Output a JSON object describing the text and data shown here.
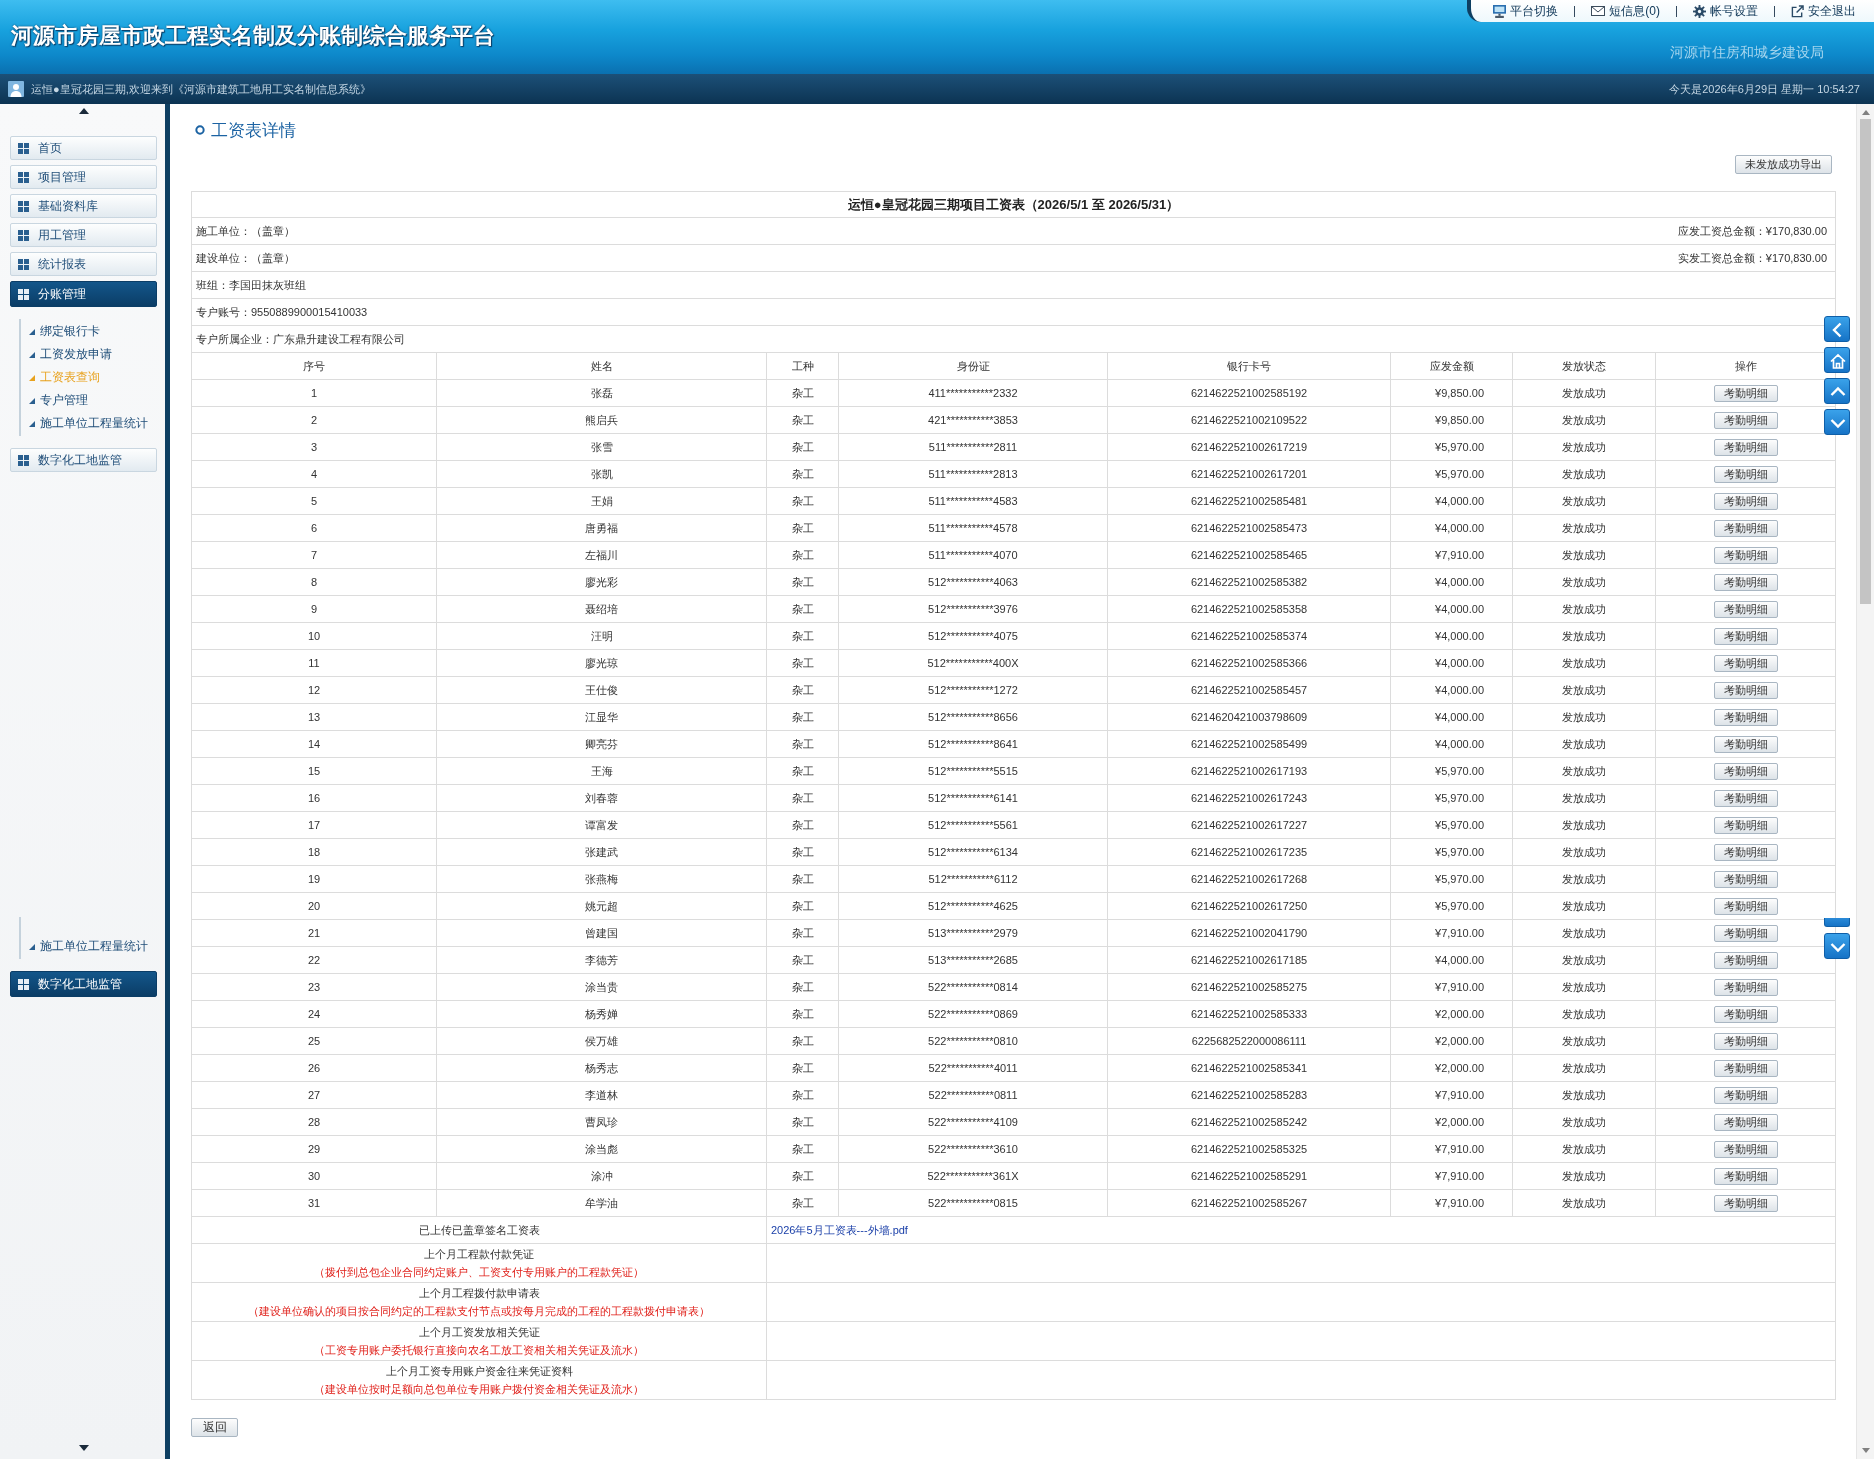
{
  "header": {
    "title": "河源市房屋市政工程实名制及分账制综合服务平台",
    "agency": "河源市住房和城乡建设局",
    "links": [
      {
        "label": "平台切换"
      },
      {
        "label": "短信息(0)"
      },
      {
        "label": "帐号设置"
      },
      {
        "label": "安全退出"
      }
    ]
  },
  "welcome_bar": {
    "message": "运恒●皇冠花园三期,欢迎来到《河源市建筑工地用工实名制信息系统》",
    "datetime": "今天是2026年6月29日 星期一 10:54:27"
  },
  "sidebar": {
    "items": [
      {
        "label": "首页",
        "selected": false
      },
      {
        "label": "项目管理",
        "selected": false
      },
      {
        "label": "基础资料库",
        "selected": false
      },
      {
        "label": "用工管理",
        "selected": false
      },
      {
        "label": "统计报表",
        "selected": false
      },
      {
        "label": "分账管理",
        "selected": true,
        "children": [
          {
            "label": "绑定银行卡",
            "selected": false
          },
          {
            "label": "工资发放申请",
            "selected": false
          },
          {
            "label": "工资表查询",
            "selected": true
          },
          {
            "label": "专户管理",
            "selected": false
          },
          {
            "label": "施工单位工程量统计",
            "selected": false
          }
        ]
      },
      {
        "label": "数字化工地监管",
        "selected": false
      }
    ]
  },
  "sidebar_fragment": {
    "items": [
      {
        "label": "施工单位工程量统计",
        "kind": "subitem"
      },
      {
        "label": "数字化工地监管",
        "kind": "item"
      }
    ]
  },
  "page": {
    "heading": "工资表详情",
    "export_button": "未发放成功导出",
    "back_button": "返回"
  },
  "payroll": {
    "title": "运恒●皇冠花园三期项目工资表（2026/5/1 至 2026/5/31）",
    "info": [
      {
        "left": "施工单位：（盖章）",
        "right": "应发工资总金额：¥170,830.00"
      },
      {
        "left": "建设单位：（盖章）",
        "right": "实发工资总金额：¥170,830.00"
      },
      {
        "left": "班组：李国田抹灰班组"
      },
      {
        "left": "专户账号：9550889900015410033"
      },
      {
        "left": "专户所属企业：广东鼎升建设工程有限公司"
      }
    ],
    "columns": [
      "序号",
      "姓名",
      "工种",
      "身份证",
      "银行卡号",
      "应发金额",
      "发放状态",
      "操作"
    ],
    "rows": [
      {
        "no": "1",
        "name": "张磊",
        "trade": "杂工",
        "id_number": "411***********2332",
        "bank_card": "6214622521002585192",
        "amount": "¥9,850.00",
        "status": "发放成功",
        "action": "考勤明细"
      },
      {
        "no": "2",
        "name": "熊启兵",
        "trade": "杂工",
        "id_number": "421***********3853",
        "bank_card": "6214622521002109522",
        "amount": "¥9,850.00",
        "status": "发放成功",
        "action": "考勤明细"
      },
      {
        "no": "3",
        "name": "张雪",
        "trade": "杂工",
        "id_number": "511***********2811",
        "bank_card": "6214622521002617219",
        "amount": "¥5,970.00",
        "status": "发放成功",
        "action": "考勤明细"
      },
      {
        "no": "4",
        "name": "张凯",
        "trade": "杂工",
        "id_number": "511***********2813",
        "bank_card": "6214622521002617201",
        "amount": "¥5,970.00",
        "status": "发放成功",
        "action": "考勤明细"
      },
      {
        "no": "5",
        "name": "王娟",
        "trade": "杂工",
        "id_number": "511***********4583",
        "bank_card": "6214622521002585481",
        "amount": "¥4,000.00",
        "status": "发放成功",
        "action": "考勤明细"
      },
      {
        "no": "6",
        "name": "唐勇福",
        "trade": "杂工",
        "id_number": "511***********4578",
        "bank_card": "6214622521002585473",
        "amount": "¥4,000.00",
        "status": "发放成功",
        "action": "考勤明细"
      },
      {
        "no": "7",
        "name": "左福川",
        "trade": "杂工",
        "id_number": "511***********4070",
        "bank_card": "6214622521002585465",
        "amount": "¥7,910.00",
        "status": "发放成功",
        "action": "考勤明细"
      },
      {
        "no": "8",
        "name": "廖光彩",
        "trade": "杂工",
        "id_number": "512***********4063",
        "bank_card": "6214622521002585382",
        "amount": "¥4,000.00",
        "status": "发放成功",
        "action": "考勤明细"
      },
      {
        "no": "9",
        "name": "聂绍培",
        "trade": "杂工",
        "id_number": "512***********3976",
        "bank_card": "6214622521002585358",
        "amount": "¥4,000.00",
        "status": "发放成功",
        "action": "考勤明细"
      },
      {
        "no": "10",
        "name": "汪明",
        "trade": "杂工",
        "id_number": "512***********4075",
        "bank_card": "6214622521002585374",
        "amount": "¥4,000.00",
        "status": "发放成功",
        "action": "考勤明细"
      },
      {
        "no": "11",
        "name": "廖光琼",
        "trade": "杂工",
        "id_number": "512***********400X",
        "bank_card": "6214622521002585366",
        "amount": "¥4,000.00",
        "status": "发放成功",
        "action": "考勤明细"
      },
      {
        "no": "12",
        "name": "王仕俊",
        "trade": "杂工",
        "id_number": "512***********1272",
        "bank_card": "6214622521002585457",
        "amount": "¥4,000.00",
        "status": "发放成功",
        "action": "考勤明细"
      },
      {
        "no": "13",
        "name": "江显华",
        "trade": "杂工",
        "id_number": "512***********8656",
        "bank_card": "6214620421003798609",
        "amount": "¥4,000.00",
        "status": "发放成功",
        "action": "考勤明细"
      },
      {
        "no": "14",
        "name": "卿亮芬",
        "trade": "杂工",
        "id_number": "512***********8641",
        "bank_card": "6214622521002585499",
        "amount": "¥4,000.00",
        "status": "发放成功",
        "action": "考勤明细"
      },
      {
        "no": "15",
        "name": "王海",
        "trade": "杂工",
        "id_number": "512***********5515",
        "bank_card": "6214622521002617193",
        "amount": "¥5,970.00",
        "status": "发放成功",
        "action": "考勤明细"
      },
      {
        "no": "16",
        "name": "刘春蓉",
        "trade": "杂工",
        "id_number": "512***********6141",
        "bank_card": "6214622521002617243",
        "amount": "¥5,970.00",
        "status": "发放成功",
        "action": "考勤明细"
      },
      {
        "no": "17",
        "name": "谭富发",
        "trade": "杂工",
        "id_number": "512***********5561",
        "bank_card": "6214622521002617227",
        "amount": "¥5,970.00",
        "status": "发放成功",
        "action": "考勤明细"
      },
      {
        "no": "18",
        "name": "张建武",
        "trade": "杂工",
        "id_number": "512***********6134",
        "bank_card": "6214622521002617235",
        "amount": "¥5,970.00",
        "status": "发放成功",
        "action": "考勤明细"
      },
      {
        "no": "19",
        "name": "张燕梅",
        "trade": "杂工",
        "id_number": "512***********6112",
        "bank_card": "6214622521002617268",
        "amount": "¥5,970.00",
        "status": "发放成功",
        "action": "考勤明细"
      },
      {
        "no": "20",
        "name": "姚元超",
        "trade": "杂工",
        "id_number": "512***********4625",
        "bank_card": "6214622521002617250",
        "amount": "¥5,970.00",
        "status": "发放成功",
        "action": "考勤明细"
      },
      {
        "no": "21",
        "name": "曾建国",
        "trade": "杂工",
        "id_number": "513***********2979",
        "bank_card": "6214622521002041790",
        "amount": "¥7,910.00",
        "status": "发放成功",
        "action": "考勤明细"
      },
      {
        "no": "22",
        "name": "李德芳",
        "trade": "杂工",
        "id_number": "513***********2685",
        "bank_card": "6214622521002617185",
        "amount": "¥4,000.00",
        "status": "发放成功",
        "action": "考勤明细"
      },
      {
        "no": "23",
        "name": "涂当贵",
        "trade": "杂工",
        "id_number": "522***********0814",
        "bank_card": "6214622521002585275",
        "amount": "¥7,910.00",
        "status": "发放成功",
        "action": "考勤明细"
      },
      {
        "no": "24",
        "name": "杨秀婵",
        "trade": "杂工",
        "id_number": "522***********0869",
        "bank_card": "6214622521002585333",
        "amount": "¥2,000.00",
        "status": "发放成功",
        "action": "考勤明细"
      },
      {
        "no": "25",
        "name": "侯万雄",
        "trade": "杂工",
        "id_number": "522***********0810",
        "bank_card": "6225682522000086111",
        "amount": "¥2,000.00",
        "status": "发放成功",
        "action": "考勤明细"
      },
      {
        "no": "26",
        "name": "杨秀志",
        "trade": "杂工",
        "id_number": "522***********4011",
        "bank_card": "6214622521002585341",
        "amount": "¥2,000.00",
        "status": "发放成功",
        "action": "考勤明细"
      },
      {
        "no": "27",
        "name": "李道林",
        "trade": "杂工",
        "id_number": "522***********0811",
        "bank_card": "6214622521002585283",
        "amount": "¥7,910.00",
        "status": "发放成功",
        "action": "考勤明细"
      },
      {
        "no": "28",
        "name": "曹凤珍",
        "trade": "杂工",
        "id_number": "522***********4109",
        "bank_card": "6214622521002585242",
        "amount": "¥2,000.00",
        "status": "发放成功",
        "action": "考勤明细"
      },
      {
        "no": "29",
        "name": "涂当彪",
        "trade": "杂工",
        "id_number": "522***********3610",
        "bank_card": "6214622521002585325",
        "amount": "¥7,910.00",
        "status": "发放成功",
        "action": "考勤明细"
      },
      {
        "no": "30",
        "name": "涂冲",
        "trade": "杂工",
        "id_number": "522***********361X",
        "bank_card": "6214622521002585291",
        "amount": "¥7,910.00",
        "status": "发放成功",
        "action": "考勤明细"
      },
      {
        "no": "31",
        "name": "牟学油",
        "trade": "杂工",
        "id_number": "522***********0815",
        "bank_card": "6214622521002585267",
        "amount": "¥7,910.00",
        "status": "发放成功",
        "action": "考勤明细"
      }
    ]
  },
  "attachments": [
    {
      "label": "已上传已盖章签名工资表",
      "file": "2026年5月工资表---外墙.pdf"
    },
    {
      "label": "上个月工程款付款凭证",
      "note": "（拨付到总包企业合同约定账户、工资支付专用账户的工程款凭证）"
    },
    {
      "label": "上个月工程拨付款申请表",
      "note": "（建设单位确认的项目按合同约定的工程款支付节点或按每月完成的工程的工程款拨付申请表）"
    },
    {
      "label": "上个月工资发放相关凭证",
      "note": "（工资专用账户委托银行直接向农名工放工资相关相关凭证及流水）"
    },
    {
      "label": "上个月工资专用账户资金往来凭证资料",
      "note": "（建设单位按时足额向总包单位专用账户拨付资金相关凭证及流水）"
    }
  ]
}
